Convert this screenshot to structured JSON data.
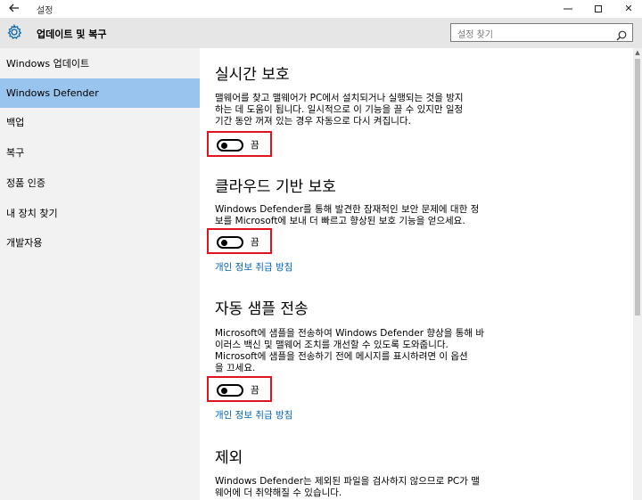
{
  "window": {
    "title": "설정",
    "back_icon": "back-arrow-icon",
    "minimize": "—",
    "close": "✕"
  },
  "header": {
    "title": "업데이트 및 복구",
    "icon": "gear-icon",
    "search_placeholder": "설정 찾기"
  },
  "sidebar": {
    "items": [
      {
        "label": "Windows 업데이트",
        "selected": false
      },
      {
        "label": "Windows Defender",
        "selected": true
      },
      {
        "label": "백업",
        "selected": false
      },
      {
        "label": "복구",
        "selected": false
      },
      {
        "label": "정품 인증",
        "selected": false
      },
      {
        "label": "내 장치 찾기",
        "selected": false
      },
      {
        "label": "개발자용",
        "selected": false
      }
    ]
  },
  "sections": {
    "realtime": {
      "title": "실시간 보호",
      "line1": "맬웨어를 찾고 맬웨어가 PC에서 설치되거나 실행되는 것을 방지",
      "line2": "하는 데 도움이 됩니다. 일시적으로 이 기능을 끌 수 있지만 일정",
      "line3": "기간 동안 꺼져 있는 경우 자동으로 다시 켜집니다.",
      "toggle_label": "끔"
    },
    "cloud": {
      "title": "클라우드 기반 보호",
      "line1": "Windows Defender를 통해 발견한 잠재적인 보안 문제에 대한 정",
      "line2": "보를 Microsoft에 보내 더 빠르고 향상된 보호 기능을 얻으세요.",
      "toggle_label": "끔",
      "link": "개인 정보 취급 방침"
    },
    "sample": {
      "title": "자동 샘플 전송",
      "line1": "Microsoft에 샘플을 전송하여 Windows Defender 향상을 통해 바",
      "line2": "이러스 백신 및 맬웨어 조치를 개선할 수 있도록 도와줍니다.",
      "line3": "Microsoft에 샘플을 전송하기 전에 메시지를 표시하려면 이 옵션",
      "line4": "을 끄세요.",
      "toggle_label": "끔",
      "link": "개인 정보 취급 방침"
    },
    "exclusion": {
      "title": "제외",
      "line1": "Windows Defender는 제외된 파일을 검사하지 않으므로 PC가 맬",
      "line2": "웨어에 더 취약해질 수 있습니다."
    }
  },
  "colors": {
    "accent_selected": "#99c4ee",
    "link": "#0063b1",
    "highlight_box": "#e0141f"
  }
}
